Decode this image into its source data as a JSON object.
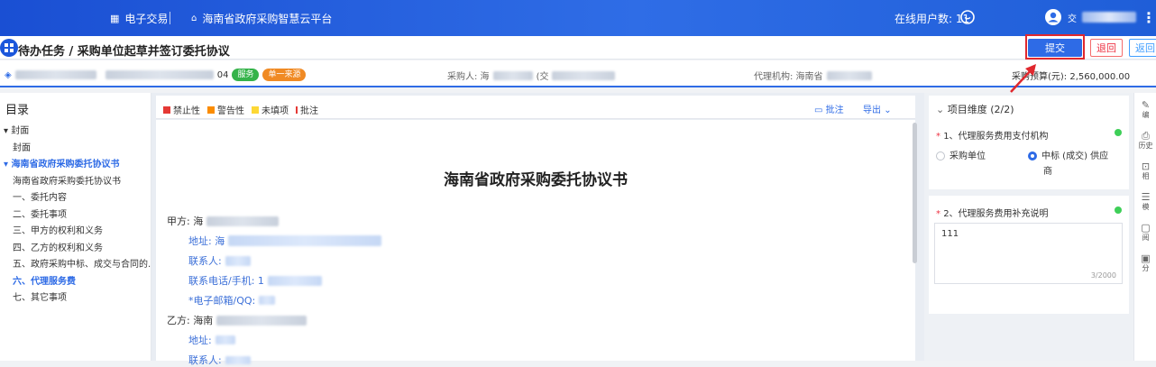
{
  "topbar": {
    "nav_electronic": "电子交易",
    "nav_platform": "海南省政府采购智慧云平台",
    "online_users": "在线用户数: 11",
    "user_name": "交",
    "icons": [
      "grid-icon",
      "home-icon",
      "chat-icon",
      "user-avatar-icon",
      "more-icon"
    ]
  },
  "header": {
    "breadcrumb": "待办任务 / 采购单位起草并签订委托协议",
    "submit_label": "提交",
    "return_label": "退回",
    "back_label": "返回"
  },
  "info": {
    "project_suffix": "04",
    "tag_service": "服务",
    "tag_single_source": "单一来源",
    "purchaser_label": "采购人: 海",
    "purchaser_paren": "(交",
    "agency_label": "代理机构: 海南省",
    "budget": "采购预算(元): 2,560,000.00"
  },
  "toc": {
    "title": "目录",
    "items": [
      {
        "label": "▾ 封面",
        "level": 0,
        "active": false
      },
      {
        "label": "封面",
        "level": 1,
        "active": false
      },
      {
        "label": "▾ 海南省政府采购委托协议书",
        "level": 0,
        "active": true
      },
      {
        "label": "海南省政府采购委托协议书",
        "level": 1,
        "active": false
      },
      {
        "label": "一、委托内容",
        "level": 1,
        "active": false
      },
      {
        "label": "二、委托事项",
        "level": 1,
        "active": false
      },
      {
        "label": "三、甲方的权利和义务",
        "level": 1,
        "active": false
      },
      {
        "label": "四、乙方的权利和义务",
        "level": 1,
        "active": false
      },
      {
        "label": "五、政府采购中标、成交与合同的...",
        "level": 1,
        "active": false
      },
      {
        "label": "六、代理服务费",
        "level": 1,
        "active": true
      },
      {
        "label": "七、其它事项",
        "level": 1,
        "active": false
      }
    ]
  },
  "doc_toolbar": {
    "legend": [
      {
        "label": "禁止性",
        "color": "#e53935"
      },
      {
        "label": "警告性",
        "color": "#fb8c00"
      },
      {
        "label": "未填项",
        "color": "#fdd835"
      },
      {
        "label": "批注",
        "color": "#e53935"
      }
    ],
    "annotate_label": "批注",
    "export_label": "导出"
  },
  "document": {
    "title": "海南省政府采购委托协议书",
    "party_a": "甲方: 海",
    "address_a": "地址: 海",
    "contact_a": "联系人:",
    "phone_a": "联系电话/手机: 1",
    "email_a": "*电子邮箱/QQ:",
    "party_b": "乙方: 海南",
    "address_b": "地址:",
    "contact_b": "联系人:"
  },
  "right_panel": {
    "section_title": "项目维度 (2/2)",
    "q1_label": "1、代理服务费用支付机构",
    "q1_options": [
      "采购单位",
      "中标 (成交) 供应",
      "商"
    ],
    "q1_selected": 1,
    "q2_label": "2、代理服务费用补充说明",
    "q2_value": "111",
    "q2_counter": "3/2000"
  },
  "rail": {
    "items": [
      {
        "label": "编",
        "icon": "edit-icon"
      },
      {
        "label": "历史",
        "icon": "history-icon"
      },
      {
        "label": "相",
        "icon": "related-icon"
      },
      {
        "label": "模",
        "icon": "template-icon"
      },
      {
        "label": "阅",
        "icon": "read-icon"
      },
      {
        "label": "分",
        "icon": "share-icon"
      }
    ]
  },
  "colors": {
    "brand": "#2e6be6",
    "highlight_frame": "#e0282e",
    "tag_service": "#35b34a",
    "tag_single_source": "#f08a24"
  }
}
